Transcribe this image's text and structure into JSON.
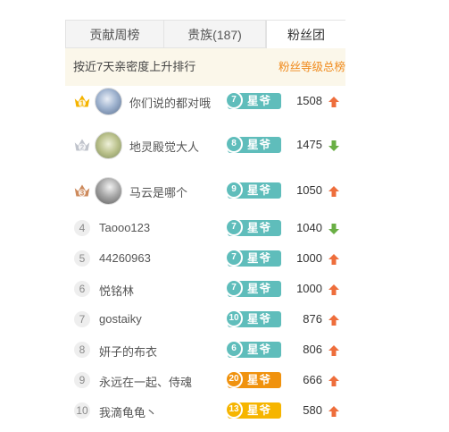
{
  "tabs": [
    {
      "label": "贡献周榜"
    },
    {
      "label": "贵族(187)"
    },
    {
      "label": "粉丝团"
    }
  ],
  "subheader": {
    "left": "按近7天亲密度上升排行",
    "right": "粉丝等级总榜"
  },
  "colors": {
    "teal_badge": "#5fbdbb",
    "orange_badge": "#f0920e",
    "gold_badge": "#f6b500",
    "up_arrow": "#ee6e3c",
    "down_arrow": "#6aaf45",
    "gold_crown": "#f5b400",
    "silver_crown": "#c0c4cc",
    "bronze_crown": "#cd8a5c"
  },
  "fans": [
    {
      "rank": "1",
      "name": "你们说的都对哦",
      "level": "7",
      "title": "星爷",
      "score": "1508",
      "trend": "up"
    },
    {
      "rank": "2",
      "name": "地灵殿觉大人",
      "level": "8",
      "title": "星爷",
      "score": "1475",
      "trend": "down"
    },
    {
      "rank": "3",
      "name": "马云是哪个",
      "level": "9",
      "title": "星爷",
      "score": "1050",
      "trend": "up"
    },
    {
      "rank": "4",
      "name": "Taooo123",
      "level": "7",
      "title": "星爷",
      "score": "1040",
      "trend": "down"
    },
    {
      "rank": "5",
      "name": "44260963",
      "level": "7",
      "title": "星爷",
      "score": "1000",
      "trend": "up"
    },
    {
      "rank": "6",
      "name": "悦铭林",
      "level": "7",
      "title": "星爷",
      "score": "1000",
      "trend": "up"
    },
    {
      "rank": "7",
      "name": "gostaiky",
      "level": "10",
      "title": "星爷",
      "score": "876",
      "trend": "up"
    },
    {
      "rank": "8",
      "name": "妍子的布衣",
      "level": "6",
      "title": "星爷",
      "score": "806",
      "trend": "up"
    },
    {
      "rank": "9",
      "name": "永远在一起、侍魂",
      "level": "20",
      "title": "星爷",
      "score": "666",
      "trend": "up"
    },
    {
      "rank": "10",
      "name": "我滴龟龟丶",
      "level": "13",
      "title": "星爷",
      "score": "580",
      "trend": "up"
    }
  ]
}
